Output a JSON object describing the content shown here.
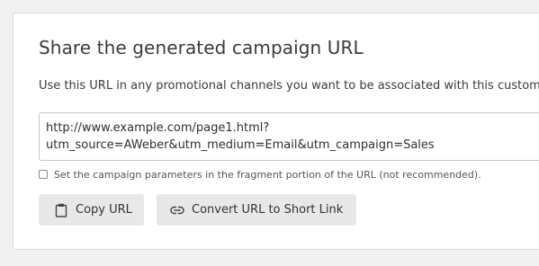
{
  "section": {
    "title": "Share the generated campaign URL",
    "description": "Use this URL in any promotional channels you want to be associated with this custom"
  },
  "url_field": {
    "line1": "http://www.example.com/page1.html?",
    "line2": "utm_source=AWeber&utm_medium=Email&utm_campaign=Sales"
  },
  "fragment_option": {
    "label": "Set the campaign parameters in the fragment portion of the URL (not recommended).",
    "checked": false
  },
  "buttons": {
    "copy_label": "Copy URL",
    "copy_icon": "clipboard-icon",
    "short_link_label": "Convert URL to Short Link",
    "short_link_icon": "link-icon"
  }
}
